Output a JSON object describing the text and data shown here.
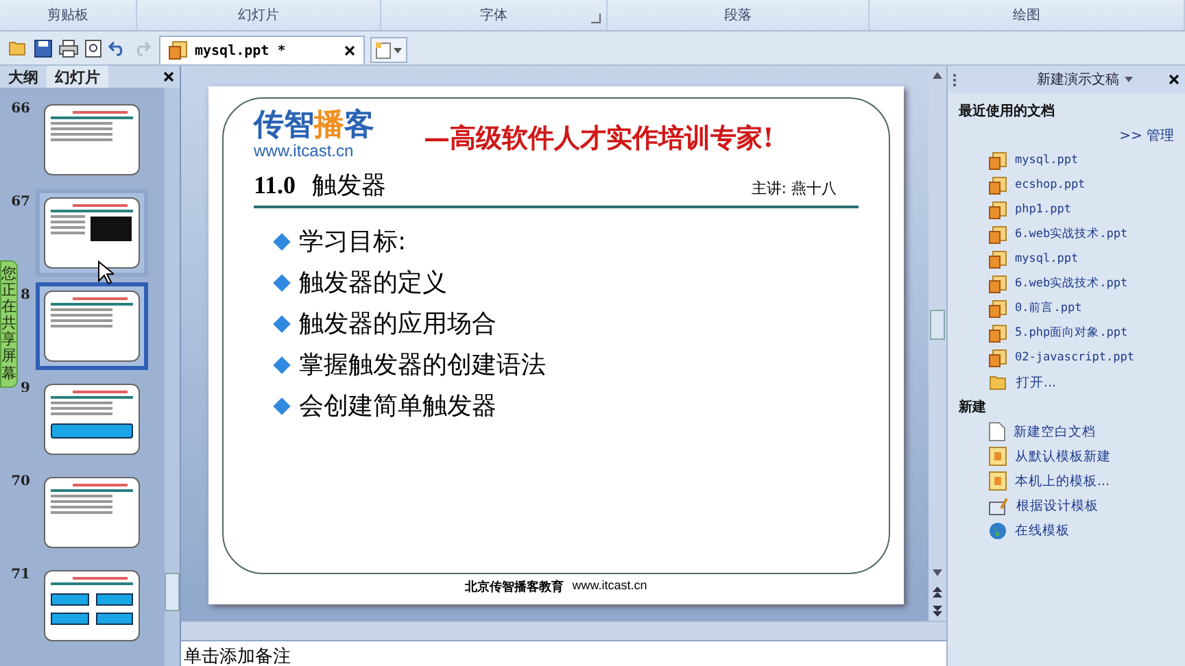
{
  "ribbon_groups": [
    {
      "label": "剪贴板",
      "launcher": false
    },
    {
      "label": "幻灯片",
      "launcher": false
    },
    {
      "label": "字体",
      "launcher": true
    },
    {
      "label": "段落",
      "launcher": false
    },
    {
      "label": "绘图",
      "launcher": false
    }
  ],
  "document_tabs": [
    {
      "label": "mysql.ppt *",
      "selected": true
    }
  ],
  "panel_tabs": [
    {
      "label": "大纲",
      "selected": false
    },
    {
      "label": "幻灯片",
      "selected": true
    }
  ],
  "thumbnails": [
    {
      "number": "66",
      "selected": false,
      "hover": false,
      "kind": "text"
    },
    {
      "number": "67",
      "selected": false,
      "hover": true,
      "kind": "terminal"
    },
    {
      "number": "8",
      "selected": true,
      "hover": false,
      "kind": "text"
    },
    {
      "number": "9",
      "selected": false,
      "hover": false,
      "kind": "box"
    },
    {
      "number": "70",
      "selected": false,
      "hover": false,
      "kind": "text"
    },
    {
      "number": "71",
      "selected": false,
      "hover": false,
      "kind": "boxes"
    }
  ],
  "share_banner": "您正在共享屏幕",
  "slide": {
    "logo": {
      "part1": "传智",
      "part2": "播",
      "part3": "客",
      "url": "www.itcast.cn"
    },
    "slogan": "—高级软件人才实作培训专家!",
    "title_number": "11.0",
    "title": "触发器",
    "presenter": "主讲: 燕十八",
    "bullets": [
      "学习目标:",
      "触发器的定义",
      "触发器的应用场合",
      "掌握触发器的创建语法",
      "会创建简单触发器"
    ],
    "footer_org": "北京传智播客教育",
    "footer_url": "www.itcast.cn"
  },
  "notes": {
    "placeholder": "单击添加备注"
  },
  "task_pane": {
    "title": "新建演示文稿",
    "recent_heading": "最近使用的文档",
    "manage": ">> 管理",
    "recent": [
      {
        "label": "mysql.ppt",
        "kind": "ppt"
      },
      {
        "label": "ecshop.ppt",
        "kind": "ppt"
      },
      {
        "label": "php1.ppt",
        "kind": "ppt"
      },
      {
        "label": "6.web实战技术.ppt",
        "kind": "ppt"
      },
      {
        "label": "mysql.ppt",
        "kind": "ppt"
      },
      {
        "label": "6.web实战技术.ppt",
        "kind": "ppt"
      },
      {
        "label": "0.前言.ppt",
        "kind": "ppt"
      },
      {
        "label": "5.php面向对象.ppt",
        "kind": "ppt"
      },
      {
        "label": "02-javascript.ppt",
        "kind": "ppt"
      },
      {
        "label": "打开...",
        "kind": "folder"
      }
    ],
    "new_heading": "新建",
    "new_items": [
      {
        "label": "新建空白文档",
        "kind": "blank"
      },
      {
        "label": "从默认模板新建",
        "kind": "template"
      },
      {
        "label": "本机上的模板...",
        "kind": "template"
      },
      {
        "label": "根据设计模板",
        "kind": "design"
      },
      {
        "label": "在线模板",
        "kind": "globe"
      }
    ]
  }
}
